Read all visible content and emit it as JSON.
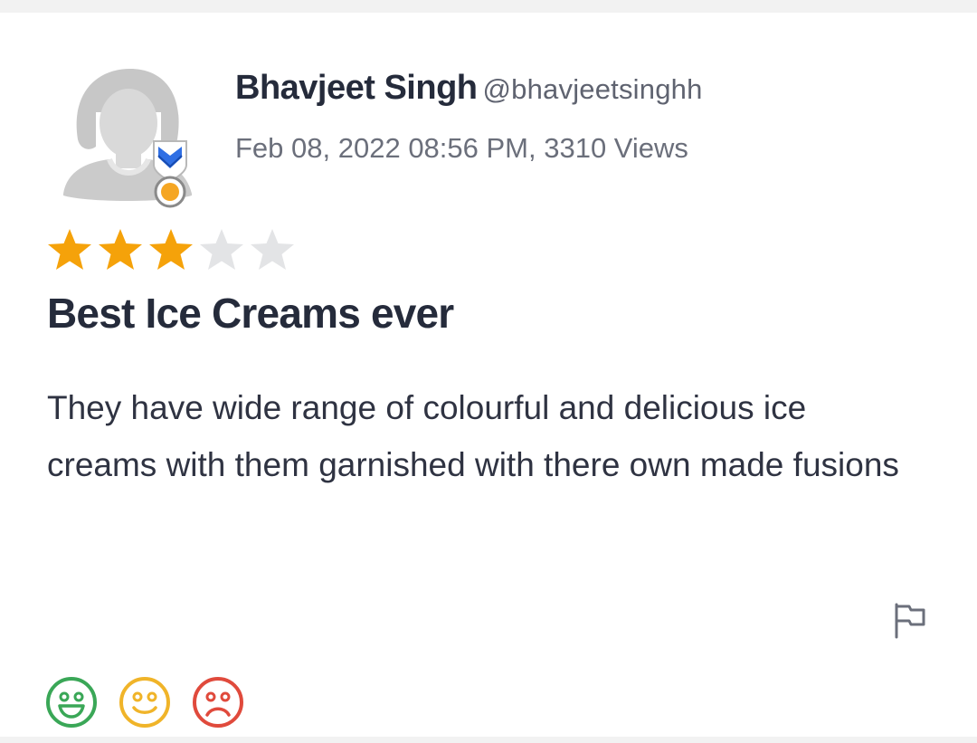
{
  "review": {
    "author_name": "Bhavjeet Singh",
    "author_handle": "@bhavjeetsinghh",
    "meta": "Feb 08, 2022 08:56 PM, 3310 Views",
    "rating": 3,
    "rating_max": 5,
    "title": "Best Ice Creams ever",
    "body": "They have wide range of colourful and delicious ice creams with them garnished with there own made fusions"
  },
  "icons": {
    "avatar": "user-avatar-placeholder",
    "badge": "shield-medal-badge-icon",
    "flag": "flag-icon",
    "reactions": [
      "happy-face-icon",
      "neutral-face-icon",
      "sad-face-icon"
    ]
  },
  "colors": {
    "star_filled": "#f5a20a",
    "star_empty": "#e3e4e6",
    "happy": "#3aa757",
    "neutral": "#f0b429",
    "sad": "#e04a3c",
    "badge_blue": "#2f6fe4",
    "badge_orange": "#f5a623"
  }
}
